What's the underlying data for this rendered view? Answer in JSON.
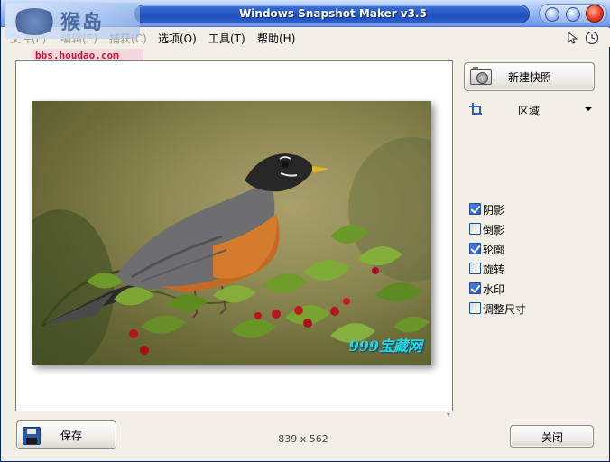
{
  "window": {
    "title": "Windows Snapshot Maker v3.5"
  },
  "logo": {
    "text": "猴岛",
    "url": "bbs.houdao.com"
  },
  "menu": {
    "items": [
      "文件(F)",
      "编辑(E)",
      "捕获(C)",
      "选项(O)",
      "工具(T)",
      "帮助(H)"
    ],
    "right_icons": [
      "cursor-icon",
      "clock-icon"
    ]
  },
  "preview": {
    "watermark": "999宝藏网",
    "resize_grip": "▾"
  },
  "panel": {
    "new_snapshot_label": "新建快照",
    "mode": {
      "selected": "区域"
    },
    "options": [
      {
        "label": "阴影",
        "checked": true
      },
      {
        "label": "倒影",
        "checked": false
      },
      {
        "label": "轮廓",
        "checked": true
      },
      {
        "label": "旋转",
        "checked": false
      },
      {
        "label": "水印",
        "checked": true
      },
      {
        "label": "调整尺寸",
        "checked": false
      }
    ]
  },
  "footer": {
    "save_label": "保存",
    "dimensions": "839 x 562",
    "close_label": "关闭"
  }
}
